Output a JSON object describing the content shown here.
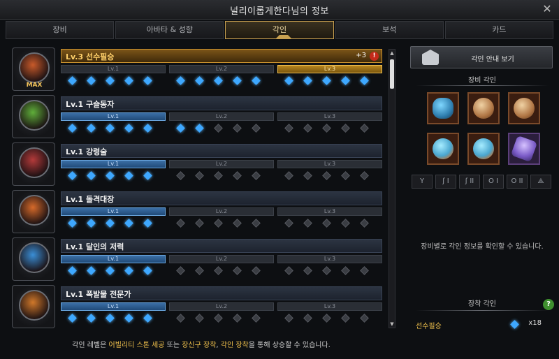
{
  "window": {
    "title": "널리이롭게한다님의 정보",
    "close_icon": "close-icon"
  },
  "tabs": [
    {
      "label": "장비",
      "active": false
    },
    {
      "label": "아바타 & 성향",
      "active": false
    },
    {
      "label": "각인",
      "active": true
    },
    {
      "label": "보석",
      "active": false
    },
    {
      "label": "카드",
      "active": false
    }
  ],
  "engravings": [
    {
      "name": "Lv.3 선수필승",
      "bonus": "+3",
      "max_label": "MAX",
      "level": 3,
      "active_gems": 15,
      "levels": [
        "Lv.1",
        "Lv.2",
        "Lv.3"
      ]
    },
    {
      "name": "Lv.1 구슬동자",
      "level": 1,
      "active_gems": 7,
      "levels": [
        "Lv.1",
        "Lv.2",
        "Lv.3"
      ]
    },
    {
      "name": "Lv.1 강령술",
      "level": 1,
      "active_gems": 5,
      "levels": [
        "Lv.1",
        "Lv.2",
        "Lv.3"
      ]
    },
    {
      "name": "Lv.1 돌격대장",
      "level": 1,
      "active_gems": 5,
      "levels": [
        "Lv.1",
        "Lv.2",
        "Lv.3"
      ]
    },
    {
      "name": "Lv.1 달인의 저력",
      "level": 1,
      "active_gems": 5,
      "levels": [
        "Lv.1",
        "Lv.2",
        "Lv.3"
      ]
    },
    {
      "name": "Lv.1 폭발물 전문가",
      "level": 1,
      "active_gems": 5,
      "levels": [
        "Lv.1",
        "Lv.2",
        "Lv.3"
      ]
    }
  ],
  "footer": {
    "prefix": "각인 레벨은 ",
    "hl1": "어빌리티 스톤 세공",
    "mid1": " 또는 ",
    "hl2": "장신구 장착",
    "mid2": ", ",
    "hl3": "각인 장착",
    "suffix": "을 통해 상승할 수 있습니다."
  },
  "right": {
    "guide_button": "각인 안내 보기",
    "equip_engrave_title": "장비 각인",
    "info_text": "장비별로 각인 정보를 확인할 수 있습니다.",
    "equipped_title": "장착 각인",
    "equipped_name": "선수필승",
    "equipped_count": "x18",
    "mini_icons": [
      "Y",
      "ʃ I",
      "ʃ II",
      "O I",
      "O II",
      "⟁"
    ]
  },
  "colors": {
    "gold": "#f4c44d",
    "gem_blue": "#3ea8ff",
    "active_tab": "#c8a050"
  }
}
